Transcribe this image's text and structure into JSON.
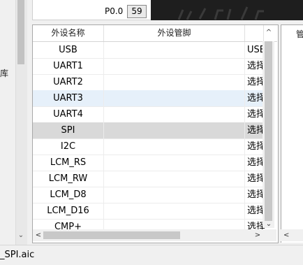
{
  "left_panel": {
    "partial_char": "库",
    "scroll_down_glyph": "⌄"
  },
  "top_panel": {
    "port_label": "P0.0",
    "port_value": "59"
  },
  "table": {
    "columns": [
      "外设名称",
      "外设管脚",
      "",
      ""
    ],
    "rows": [
      {
        "name": "USB",
        "pin": "",
        "action": "USB"
      },
      {
        "name": "UART1",
        "pin": "",
        "action": "选择"
      },
      {
        "name": "UART2",
        "pin": "",
        "action": "选择"
      },
      {
        "name": "UART3",
        "pin": "",
        "action": "选择"
      },
      {
        "name": "UART4",
        "pin": "",
        "action": "选择"
      },
      {
        "name": "SPI",
        "pin": "",
        "action": "选择"
      },
      {
        "name": "I2C",
        "pin": "",
        "action": "选择"
      },
      {
        "name": "LCM_RS",
        "pin": "",
        "action": "选择"
      },
      {
        "name": "LCM_RW",
        "pin": "",
        "action": "选择"
      },
      {
        "name": "LCM_D8",
        "pin": "",
        "action": "选择"
      },
      {
        "name": "LCM_D16",
        "pin": "",
        "action": "选择"
      },
      {
        "name": "CMP+",
        "pin": "",
        "action": "选择"
      }
    ],
    "scroll_up_glyph": "^",
    "scroll_down_glyph": "⌄",
    "scroll_left_glyph": "<",
    "scroll_right_glyph": ">"
  },
  "right_panel": {
    "header_partial": "管",
    "scroll_left_glyph": "<"
  },
  "status_bar": {
    "filename": "_SPI.aic"
  },
  "colors": {
    "selected_light": "#e6f0fa",
    "selected_grey": "#d9d9d9"
  }
}
